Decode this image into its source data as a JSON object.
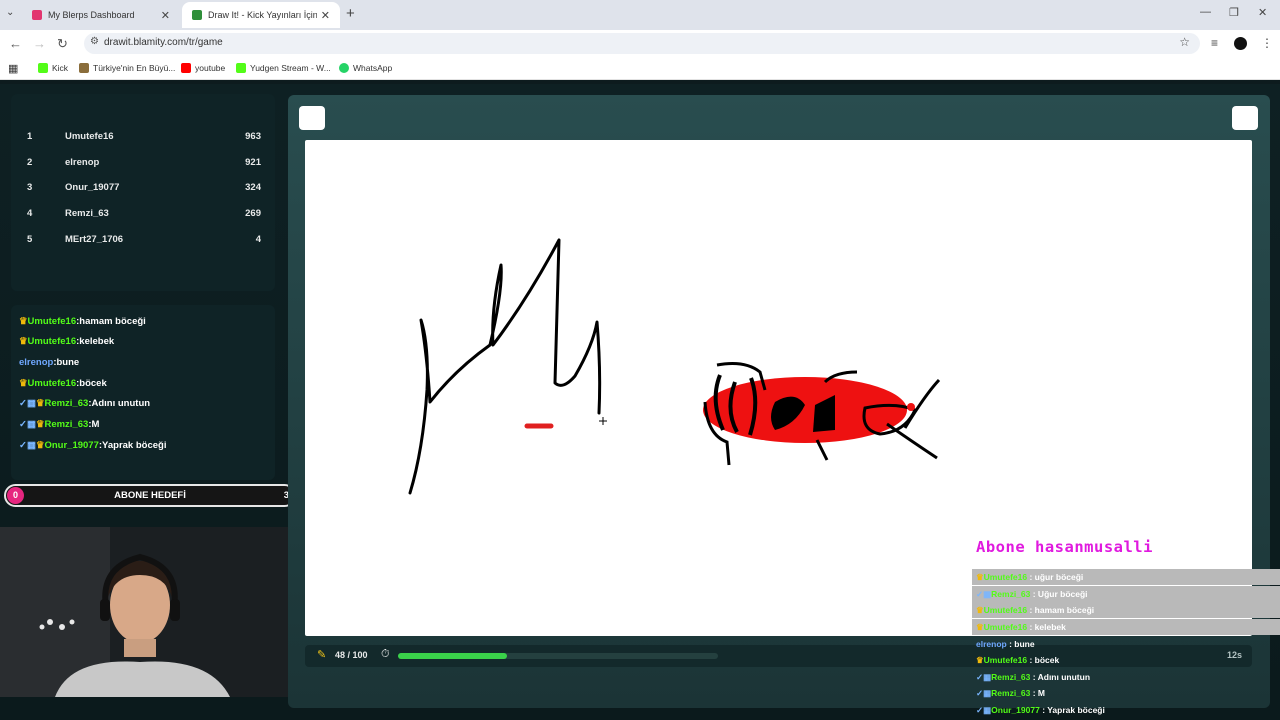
{
  "browser": {
    "tabs": [
      {
        "title": "My Blerps Dashboard",
        "favicon_color": "#e2356f"
      },
      {
        "title": "Draw It! - Kick Yayınları İçin Çizi",
        "favicon_color": "#2f8f3a"
      }
    ],
    "url": "drawit.blamity.com/tr/game",
    "bookmarks": [
      {
        "label": "Kick",
        "color": "#53fc18"
      },
      {
        "label": "Türkiye'nin En Büyü...",
        "color": "#8a6d3b"
      },
      {
        "label": "youtube",
        "color": "#ff0000"
      },
      {
        "label": "Yudgen Stream - W...",
        "color": "#53fc18"
      },
      {
        "label": "WhatsApp",
        "color": "#25d366"
      }
    ]
  },
  "leaderboard": [
    {
      "rank": "1",
      "name": "Umutefe16",
      "score": "963"
    },
    {
      "rank": "2",
      "name": "elrenop",
      "score": "921"
    },
    {
      "rank": "3",
      "name": "Onur_19077",
      "score": "324"
    },
    {
      "rank": "4",
      "name": "Remzi_63",
      "score": "269"
    },
    {
      "rank": "5",
      "name": "MErt27_1706",
      "score": "4"
    }
  ],
  "chat": [
    {
      "user": "Umutefe16",
      "msg": "hamam böceği"
    },
    {
      "user": "Umutefe16",
      "msg": "kelebek"
    },
    {
      "user": "elrenop",
      "msg": "bune"
    },
    {
      "user": "Umutefe16",
      "msg": "böcek"
    },
    {
      "user": "Remzi_63",
      "msg": "Adını unutun"
    },
    {
      "user": "Remzi_63",
      "msg": "M"
    },
    {
      "user": "Onur_19077",
      "msg": "Yaprak böceği"
    }
  ],
  "sub_goal": {
    "current": "0",
    "label": "ABONE HEDEFİ",
    "target": "3"
  },
  "game": {
    "drawn_count": "48 / 100",
    "progress": 0.34,
    "timer": "12s"
  },
  "overlay": {
    "title": "Abone hasanmusalli",
    "lines": [
      {
        "user": "Umutefe16",
        "msg": " : uğur böceği"
      },
      {
        "user": "Remzi_63",
        "msg": " : Uğur böceği"
      },
      {
        "user": "Umutefe16",
        "msg": " : hamam böceği"
      },
      {
        "user": "Umutefe16",
        "msg": " : kelebek"
      },
      {
        "user": "elrenop",
        "msg": " : bune"
      },
      {
        "user": "Umutefe16",
        "msg": " : böcek"
      },
      {
        "user": "Remzi_63",
        "msg": " : Adını unutun"
      },
      {
        "user": "Remzi_63",
        "msg": " : M"
      },
      {
        "user": "Onur_19077",
        "msg": " : Yaprak böceği"
      }
    ]
  }
}
